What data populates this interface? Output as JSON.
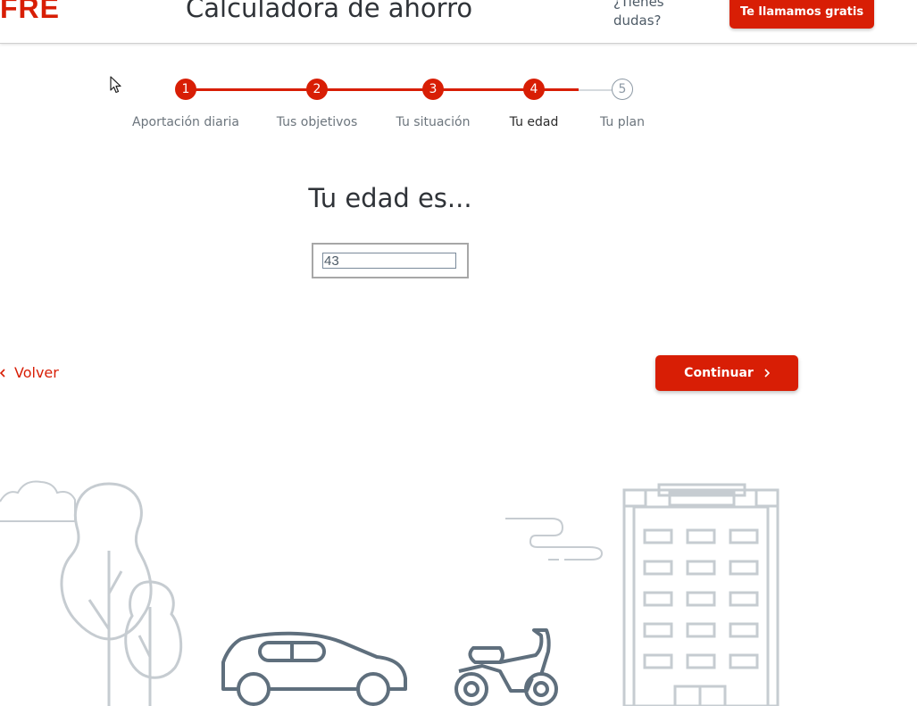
{
  "header": {
    "logo": "FRE",
    "title": "Calculadora de ahorro",
    "help_line1": "¿Tienes",
    "help_line2": "dudas?",
    "call_button": "Te llamamos gratis"
  },
  "stepper": {
    "steps": [
      {
        "number": "1",
        "label": "Aportación diaria"
      },
      {
        "number": "2",
        "label": "Tus objetivos"
      },
      {
        "number": "3",
        "label": "Tu situación"
      },
      {
        "number": "4",
        "label": "Tu edad"
      },
      {
        "number": "5",
        "label": "Tu plan"
      }
    ],
    "current_step": 4
  },
  "form": {
    "question": "Tu edad es...",
    "age_value": "43"
  },
  "nav": {
    "back_label": "Volver",
    "continue_label": "Continuar"
  },
  "colors": {
    "accent": "#d81e05",
    "illustration": "#5f6f7d",
    "illustration_light": "#c6ccd1"
  }
}
